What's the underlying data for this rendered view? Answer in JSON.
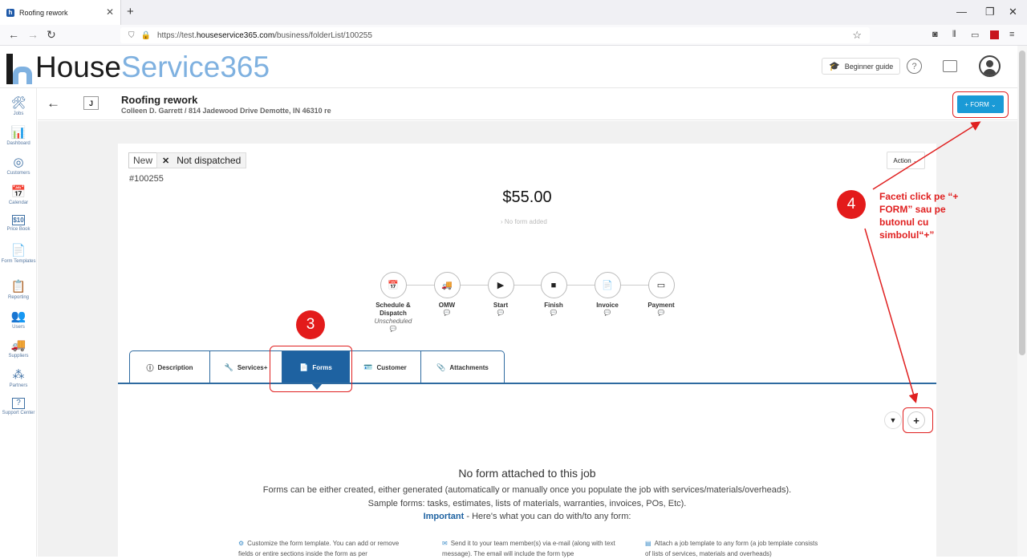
{
  "browser": {
    "tab_title": "Roofing rework",
    "tab_favicon": "h",
    "tab_close": "✕",
    "new_tab": "+",
    "minimize": "—",
    "restore": "❐",
    "close": "✕",
    "back": "←",
    "forward": "→",
    "reload": "↻",
    "url_prefix": "https://test.",
    "url_domain": "houseservice365.com",
    "url_path": "/business/folderList/100255"
  },
  "header": {
    "logo_part1": "House",
    "logo_part2": "Service365",
    "beginner_guide": "Beginner guide",
    "help": "?"
  },
  "sidebar": {
    "items": [
      {
        "label": "Jobs",
        "icon": "🛠"
      },
      {
        "label": "Dashboard",
        "icon": "📊"
      },
      {
        "label": "Customers",
        "icon": "◎"
      },
      {
        "label": "Calendar",
        "icon": "📅"
      },
      {
        "label": "Price Book",
        "icon": "$10"
      },
      {
        "label": "Form Templates",
        "icon": "📄"
      },
      {
        "label": "Reporting",
        "icon": "📋"
      },
      {
        "label": "Users",
        "icon": "👥"
      },
      {
        "label": "Suppliers",
        "icon": "🚚"
      },
      {
        "label": "Partners",
        "icon": "⁂"
      },
      {
        "label": "Support Center",
        "icon": "?"
      }
    ]
  },
  "job": {
    "letter": "J",
    "title": "Roofing rework",
    "subtitle": "Colleen D. Garrett / 814 Jadewood Drive Demotte, IN 46310 re",
    "form_button": "+ FORM ⌄",
    "status_new": "New",
    "status_dispatch": "Not dispatched",
    "number": "#100255",
    "action_button": "Action ⌄",
    "price": "$55.00",
    "no_form_added": "› No form added"
  },
  "steps": [
    {
      "label": "Schedule & Dispatch",
      "sub": "Unscheduled",
      "icon": "📅"
    },
    {
      "label": "OMW",
      "sub": "",
      "icon": "🚚"
    },
    {
      "label": "Start",
      "sub": "",
      "icon": "▶"
    },
    {
      "label": "Finish",
      "sub": "",
      "icon": "■"
    },
    {
      "label": "Invoice",
      "sub": "",
      "icon": "📄"
    },
    {
      "label": "Payment",
      "sub": "",
      "icon": "▭"
    }
  ],
  "tabs": [
    {
      "label": "Description",
      "icon": "ⓘ"
    },
    {
      "label": "Services+",
      "icon": "🔧"
    },
    {
      "label": "Forms",
      "icon": "📄"
    },
    {
      "label": "Customer",
      "icon": "🪪"
    },
    {
      "label": "Attachments",
      "icon": "📎"
    }
  ],
  "forms_panel": {
    "filter": "▼",
    "add": "+",
    "empty_title": "No form attached to this job",
    "line1": "Forms can be either created, either generated (automatically or manually once you populate the job with services/materials/overheads).",
    "line2": "Sample forms: tasks, estimates, lists of materials, warranties, invoices, POs, Etc).",
    "important": "Important",
    "line3": " - Here's what you can do with/to any form:",
    "col1": "Customize the form template. You can add or remove fields or entire sections inside the form as per",
    "col2": "Send it to your team member(s) via e-mail (along with text message). The email will include the form type",
    "col3": "Attach a job template to any form (a job template consists of lists of services, materials and overheads)"
  },
  "annotations": {
    "badge3": "3",
    "badge4": "4",
    "callout": "Faceti click pe “+ FORM” sau pe butonul cu simbolul“+”",
    "color": "#e02020"
  }
}
